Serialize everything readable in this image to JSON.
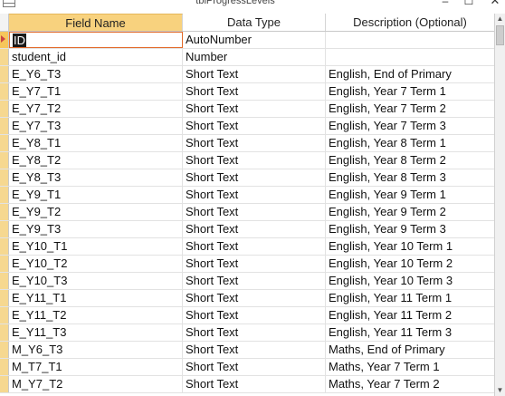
{
  "window": {
    "title": "tblProgressLevels",
    "minimize_glyph": "–",
    "maximize_glyph": "☐",
    "close_glyph": "✕"
  },
  "columns": {
    "field_name": "Field Name",
    "data_type": "Data Type",
    "description": "Description (Optional)"
  },
  "rows": [
    {
      "name": "ID",
      "type": "AutoNumber",
      "desc": ""
    },
    {
      "name": "student_id",
      "type": "Number",
      "desc": ""
    },
    {
      "name": "E_Y6_T3",
      "type": "Short Text",
      "desc": "English, End of Primary"
    },
    {
      "name": "E_Y7_T1",
      "type": "Short Text",
      "desc": "English, Year 7 Term 1"
    },
    {
      "name": "E_Y7_T2",
      "type": "Short Text",
      "desc": "English, Year 7 Term 2"
    },
    {
      "name": "E_Y7_T3",
      "type": "Short Text",
      "desc": "English, Year 7 Term 3"
    },
    {
      "name": "E_Y8_T1",
      "type": "Short Text",
      "desc": "English, Year 8 Term 1"
    },
    {
      "name": "E_Y8_T2",
      "type": "Short Text",
      "desc": "English, Year 8 Term 2"
    },
    {
      "name": "E_Y8_T3",
      "type": "Short Text",
      "desc": "English, Year 8 Term 3"
    },
    {
      "name": "E_Y9_T1",
      "type": "Short Text",
      "desc": "English, Year 9 Term 1"
    },
    {
      "name": "E_Y9_T2",
      "type": "Short Text",
      "desc": "English, Year 9 Term 2"
    },
    {
      "name": "E_Y9_T3",
      "type": "Short Text",
      "desc": "English, Year 9 Term 3"
    },
    {
      "name": "E_Y10_T1",
      "type": "Short Text",
      "desc": "English, Year 10 Term 1"
    },
    {
      "name": "E_Y10_T2",
      "type": "Short Text",
      "desc": "English, Year 10 Term 2"
    },
    {
      "name": "E_Y10_T3",
      "type": "Short Text",
      "desc": "English, Year 10 Term 3"
    },
    {
      "name": "E_Y11_T1",
      "type": "Short Text",
      "desc": "English, Year 11 Term 1"
    },
    {
      "name": "E_Y11_T2",
      "type": "Short Text",
      "desc": "English, Year 11 Term 2"
    },
    {
      "name": "E_Y11_T3",
      "type": "Short Text",
      "desc": "English, Year 11 Term 3"
    },
    {
      "name": "M_Y6_T3",
      "type": "Short Text",
      "desc": "Maths, End of Primary"
    },
    {
      "name": "M_T7_T1",
      "type": "Short Text",
      "desc": "Maths, Year 7 Term 1"
    },
    {
      "name": "M_Y7_T2",
      "type": "Short Text",
      "desc": "Maths, Year 7 Term 2"
    }
  ],
  "scrollbar": {
    "up_glyph": "▲",
    "down_glyph": "▼"
  },
  "colors": {
    "header_highlight": "#f8d27e",
    "row_selector": "#f6c65b",
    "active_border": "#e36a2a"
  }
}
